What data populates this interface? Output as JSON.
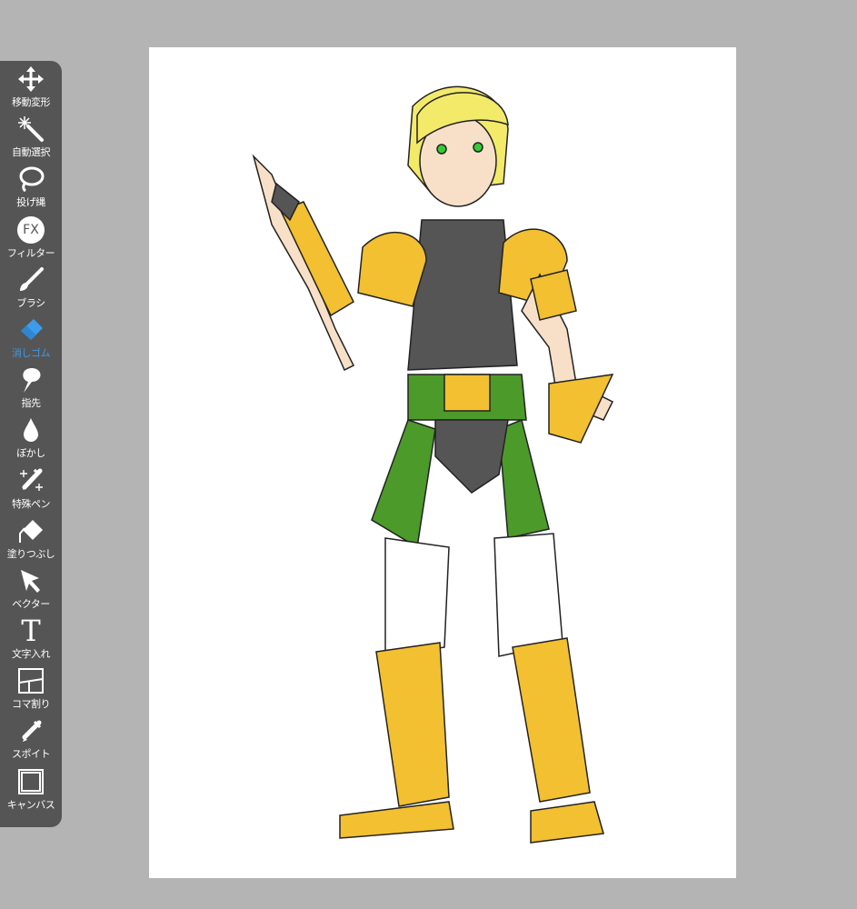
{
  "toolbar": {
    "active_tool": "eraser",
    "accent_color": "#3d9be9",
    "tools": [
      {
        "id": "transform",
        "label": "移動変形",
        "icon": "move-arrows-icon"
      },
      {
        "id": "magic-wand",
        "label": "自動選択",
        "icon": "magic-wand-icon"
      },
      {
        "id": "lasso",
        "label": "投げ縄",
        "icon": "lasso-icon"
      },
      {
        "id": "filter",
        "label": "フィルター",
        "icon": "fx-icon",
        "icon_text": "FX"
      },
      {
        "id": "brush",
        "label": "ブラシ",
        "icon": "brush-icon"
      },
      {
        "id": "eraser",
        "label": "消しゴム",
        "icon": "eraser-icon"
      },
      {
        "id": "smudge",
        "label": "指先",
        "icon": "finger-icon"
      },
      {
        "id": "blur",
        "label": "ぼかし",
        "icon": "drop-icon"
      },
      {
        "id": "special-pen",
        "label": "特殊ペン",
        "icon": "sparkle-pen-icon"
      },
      {
        "id": "fill",
        "label": "塗りつぶし",
        "icon": "bucket-icon"
      },
      {
        "id": "vector",
        "label": "ベクター",
        "icon": "arrow-cursor-icon"
      },
      {
        "id": "text",
        "label": "文字入れ",
        "icon": "text-icon",
        "icon_text": "T"
      },
      {
        "id": "frame",
        "label": "コマ割り",
        "icon": "panel-icon"
      },
      {
        "id": "eyedropper",
        "label": "スポイト",
        "icon": "eyedropper-icon"
      },
      {
        "id": "canvas",
        "label": "キャンバス",
        "icon": "canvas-icon"
      }
    ]
  }
}
